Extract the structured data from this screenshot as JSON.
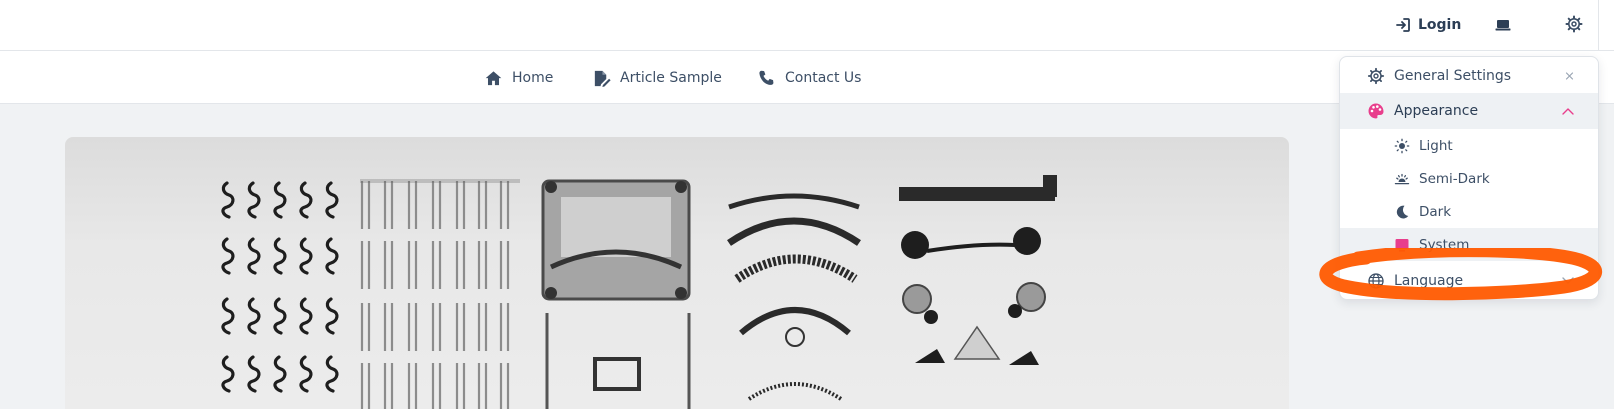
{
  "header": {
    "login_label": "Login",
    "icons": [
      "login-icon",
      "laptop-icon",
      "gear-icon"
    ]
  },
  "nav": {
    "items": [
      {
        "label": "Home",
        "icon": "home-icon"
      },
      {
        "label": "Article Sample",
        "icon": "edit-document-icon"
      },
      {
        "label": "Contact Us",
        "icon": "phone-icon"
      }
    ]
  },
  "hero": {
    "image": "disassembled-typewriter-parts-photo"
  },
  "settings_menu": {
    "general_settings": "General Settings",
    "appearance": "Appearance",
    "appearance_options": [
      "Light",
      "Semi-Dark",
      "Dark",
      "System"
    ],
    "selected_option": "System",
    "language": "Language",
    "accent_color": "#e83e8c",
    "annotation_color": "#ff5a00"
  }
}
